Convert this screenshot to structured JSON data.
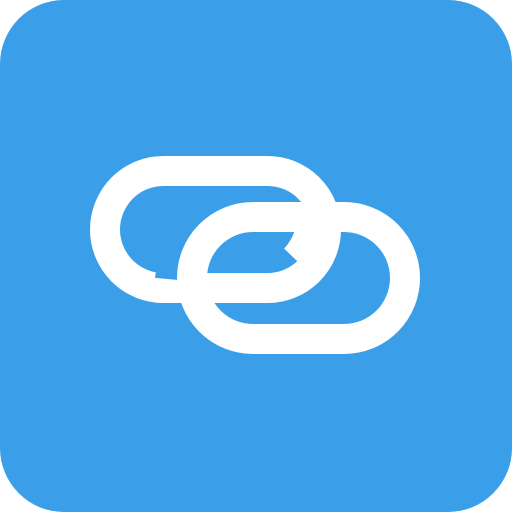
{
  "app_icon": {
    "icon": "link-icon",
    "colors": {
      "background": "#3a9fe8",
      "glyph": "#ffffff"
    }
  }
}
